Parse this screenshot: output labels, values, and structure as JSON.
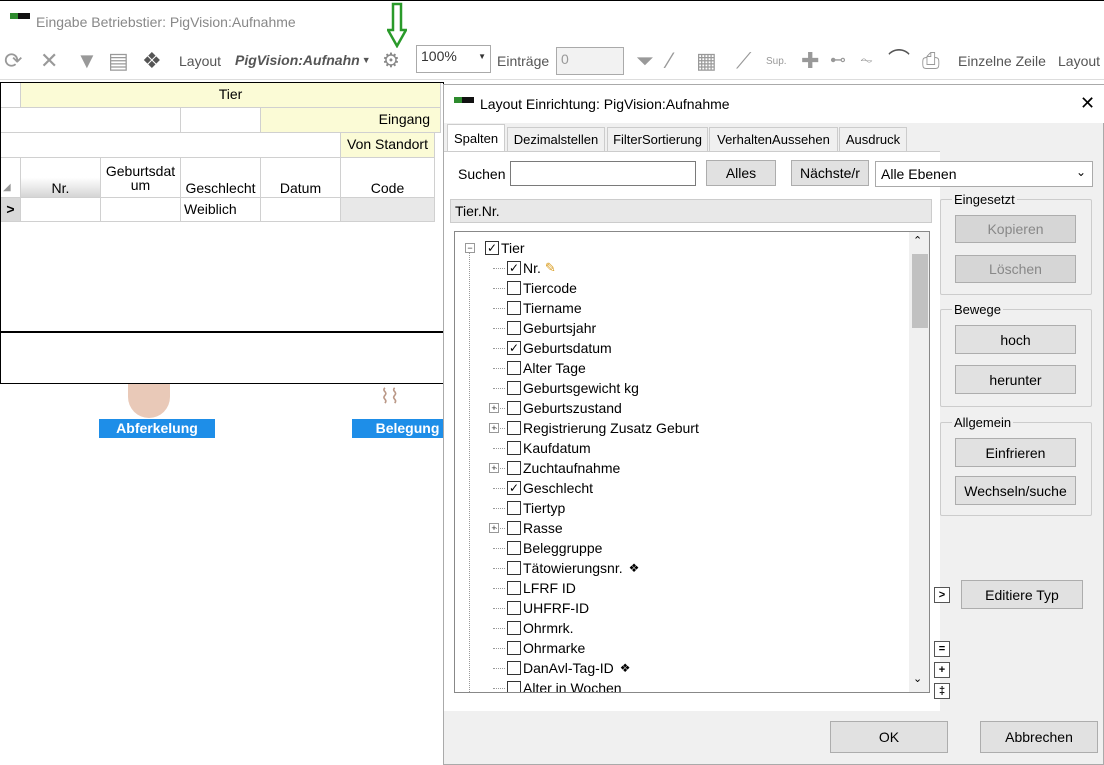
{
  "window": {
    "title": "Eingabe Betriebstier: PigVision:Aufnahme"
  },
  "toolbar": {
    "layout_label": "Layout",
    "layout_combo": "PigVision:Aufnahn",
    "zoom": "100%",
    "entries_label": "Einträge",
    "entries_value": "0",
    "sup_label": "Sup.",
    "single_row_label": "Einzelne Zeile",
    "layout_label2": "Layout"
  },
  "grid": {
    "group_tier": "Tier",
    "group_eingang": "Eingang",
    "group_von_standort": "Von Standort",
    "columns": [
      "Nr.",
      "Geburtsdat um",
      "Geschlecht",
      "Datum",
      "Code"
    ],
    "row_marker": ">",
    "row": [
      "",
      "",
      "Weiblich",
      "",
      ""
    ]
  },
  "tiles": {
    "abferkelung": "Abferkelung",
    "belegung": "Belegung"
  },
  "dialog": {
    "title": "Layout Einrichtung: PigVision:Aufnahme",
    "tabs": [
      "Spalten",
      "Dezimalstellen",
      "FilterSortierung",
      "VerhaltenAussehen",
      "Ausdruck"
    ],
    "search_label": "Suchen",
    "search_value": "",
    "btn_alles": "Alles",
    "btn_naechste": "Nächste/r",
    "level_select": "Alle Ebenen",
    "path": "Tier.Nr.",
    "tree": [
      {
        "label": "Tier",
        "checked": true,
        "level": 0,
        "expander": "minus"
      },
      {
        "label": "Nr.",
        "checked": true,
        "level": 1,
        "pencil": true
      },
      {
        "label": "Tiercode",
        "checked": false,
        "level": 1
      },
      {
        "label": "Tiername",
        "checked": false,
        "level": 1
      },
      {
        "label": "Geburtsjahr",
        "checked": false,
        "level": 1
      },
      {
        "label": "Geburtsdatum",
        "checked": true,
        "level": 1
      },
      {
        "label": "Alter Tage",
        "checked": false,
        "level": 1
      },
      {
        "label": "Geburtsgewicht kg",
        "checked": false,
        "level": 1
      },
      {
        "label": "Geburtszustand",
        "checked": false,
        "level": 1,
        "expander": "plus"
      },
      {
        "label": "Registrierung Zusatz Geburt",
        "checked": false,
        "level": 1,
        "expander": "plus"
      },
      {
        "label": "Kaufdatum",
        "checked": false,
        "level": 1
      },
      {
        "label": "Zuchtaufnahme",
        "checked": false,
        "level": 1,
        "expander": "plus"
      },
      {
        "label": "Geschlecht",
        "checked": true,
        "level": 1
      },
      {
        "label": "Tiertyp",
        "checked": false,
        "level": 1
      },
      {
        "label": "Rasse",
        "checked": false,
        "level": 1,
        "expander": "plus"
      },
      {
        "label": "Beleggruppe",
        "checked": false,
        "level": 1
      },
      {
        "label": "Tätowierungsnr.",
        "checked": false,
        "level": 1,
        "icon": true
      },
      {
        "label": "LFRF ID",
        "checked": false,
        "level": 1
      },
      {
        "label": "UHFRF-ID",
        "checked": false,
        "level": 1
      },
      {
        "label": "Ohrmrk.",
        "checked": false,
        "level": 1
      },
      {
        "label": "Ohrmarke",
        "checked": false,
        "level": 1
      },
      {
        "label": "DanAvl-Tag-ID",
        "checked": false,
        "level": 1,
        "icon": true
      },
      {
        "label": "Alter in Wochen",
        "checked": false,
        "level": 1
      }
    ],
    "group_eingesetzt": "Eingesetzt",
    "btn_kopieren": "Kopieren",
    "btn_loeschen": "Löschen",
    "group_bewege": "Bewege",
    "btn_hoch": "hoch",
    "btn_herunter": "herunter",
    "group_allgemein": "Allgemein",
    "btn_einfrieren": "Einfrieren",
    "btn_wechseln": "Wechseln/suche",
    "btn_edit_type": "Editiere Typ",
    "btn_expand": ">",
    "side_small": [
      "=",
      "+",
      "‡"
    ],
    "btn_ok": "OK",
    "btn_cancel": "Abbrechen"
  }
}
